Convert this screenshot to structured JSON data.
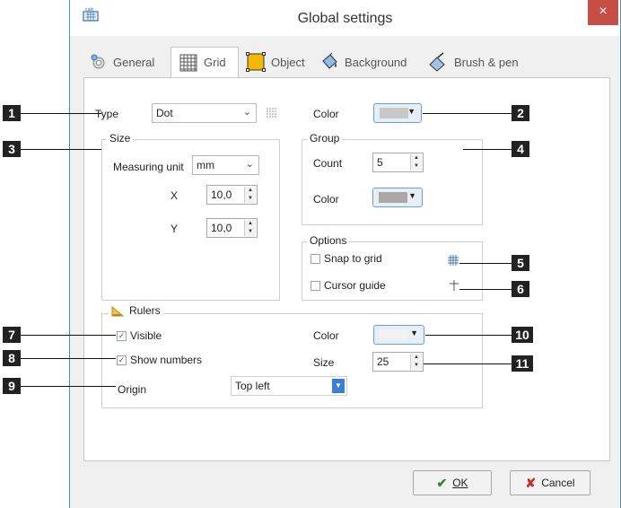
{
  "window": {
    "title": "Global settings",
    "close": "×"
  },
  "tabs": [
    {
      "label": "General"
    },
    {
      "label": "Grid"
    },
    {
      "label": "Object"
    },
    {
      "label": "Background"
    },
    {
      "label": "Brush & pen"
    }
  ],
  "grid": {
    "type_label": "Type",
    "type_value": "Dot",
    "color_label": "Color",
    "size": {
      "group_label": "Size",
      "unit_label": "Measuring unit",
      "unit_value": "mm",
      "x_label": "X",
      "x_value": "10,0",
      "y_label": "Y",
      "y_value": "10,0"
    },
    "group": {
      "group_label": "Group",
      "count_label": "Count",
      "count_value": "5",
      "color_label": "Color"
    },
    "options": {
      "group_label": "Options",
      "snap_label": "Snap to grid",
      "cursor_label": "Cursor guide"
    },
    "rulers": {
      "group_label": "Rulers",
      "visible_label": "Visible",
      "numbers_label": "Show numbers",
      "origin_label": "Origin",
      "origin_value": "Top left",
      "color_label": "Color",
      "size_label": "Size",
      "size_value": "25"
    }
  },
  "buttons": {
    "ok": "OK",
    "cancel": "Cancel"
  },
  "callouts": [
    "1",
    "2",
    "3",
    "4",
    "5",
    "6",
    "7",
    "8",
    "9",
    "10",
    "11"
  ],
  "colors": {
    "grid_color": "#c8c8c8",
    "group_color": "#a9a9a9",
    "ruler_color": "#f2f2f2",
    "accent": "#4a90c8",
    "close": "#c74e45"
  }
}
